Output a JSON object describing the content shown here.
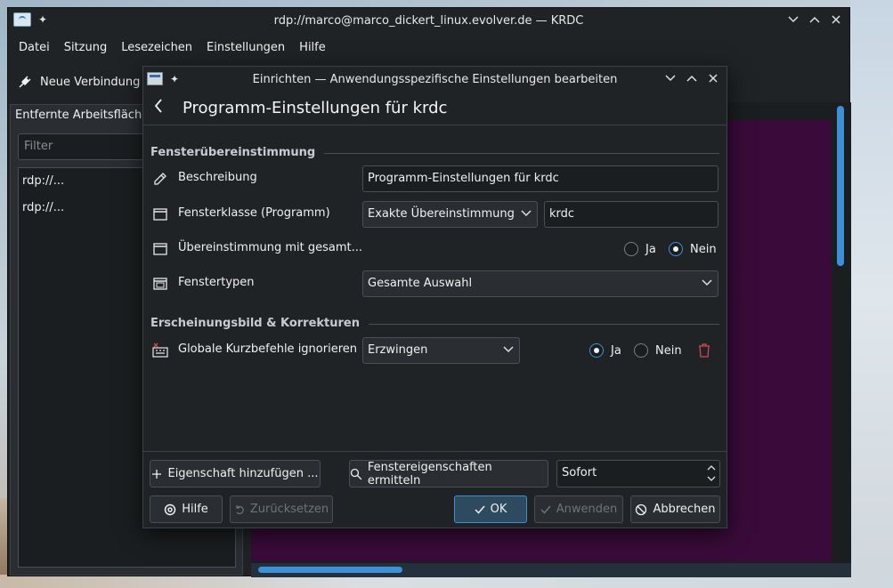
{
  "main_window": {
    "title": "rdp://marco@marco_dickert_linux.evolver.de — KRDC",
    "menu": [
      "Datei",
      "Sitzung",
      "Lesezeichen",
      "Einstellungen",
      "Hilfe"
    ],
    "toolbar": {
      "new_connection": "Neue Verbindung"
    },
    "left_panel": {
      "title": "Entfernte Arbeitsflächen",
      "filter_placeholder": "Filter",
      "connections": [
        "rdp://...",
        "rdp://..."
      ]
    },
    "remote_color": "#3a0b3a"
  },
  "dialog": {
    "title": "Einrichten — Anwendungsspezifische Einstellungen bearbeiten",
    "header": "Programm-Einstellungen für krdc",
    "sections": {
      "window_matching": "Fensterübereinstimmung",
      "appearance": "Erscheinungsbild & Korrekturen"
    },
    "rows": {
      "description": {
        "label": "Beschreibung",
        "value": "Programm-Einstellungen für krdc"
      },
      "window_class": {
        "label": "Fensterklasse (Programm)",
        "match": "Exakte Übereinstimmung",
        "value": "krdc"
      },
      "whole_class": {
        "label": "Übereinstimmung mit gesamt...",
        "yes": "Ja",
        "no": "Nein",
        "selected": "Nein"
      },
      "window_types": {
        "label": "Fenstertypen",
        "value": "Gesamte Auswahl"
      },
      "global_shortcuts": {
        "label": "Globale Kurzbefehle ignorieren",
        "policy": "Erzwingen",
        "yes": "Ja",
        "no": "Nein",
        "selected": "Ja"
      }
    },
    "footer": {
      "add_property": "Eigenschaft hinzufügen ...",
      "detect": "Fenstereigenschaften ermitteln",
      "delay": "Sofort",
      "help": "Hilfe",
      "reset": "Zurücksetzen",
      "ok": "OK",
      "apply": "Anwenden",
      "cancel": "Abbrechen"
    }
  },
  "colors": {
    "accent": "#3d8fd6",
    "danger": "#da4453",
    "bg": "#202326"
  }
}
